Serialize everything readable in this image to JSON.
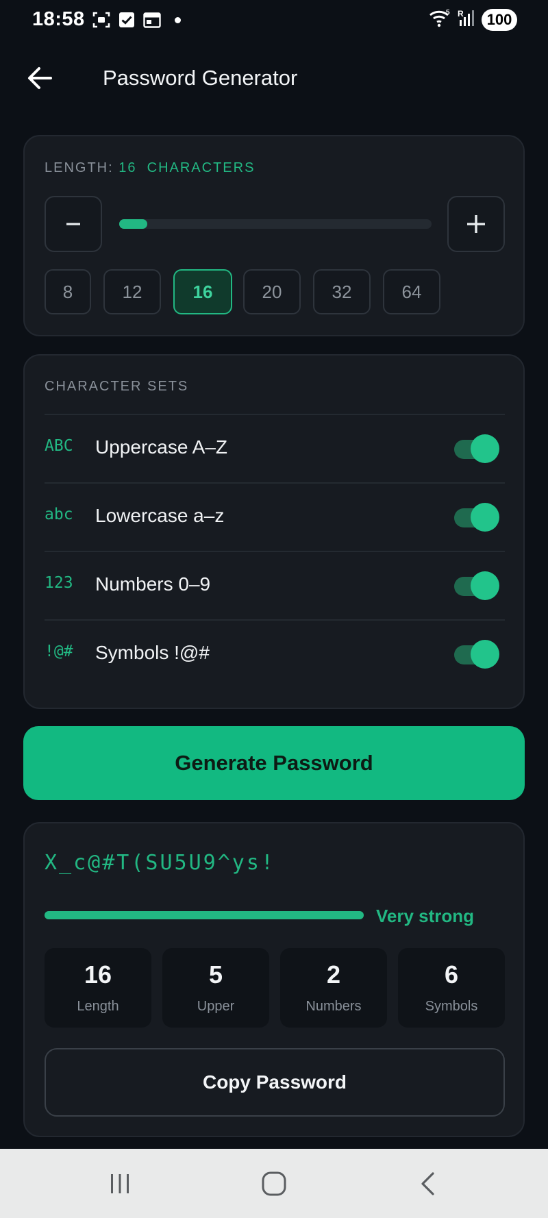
{
  "status_bar": {
    "time": "18:58",
    "battery": "100",
    "icons": [
      "screenshot-icon",
      "checkbox-icon",
      "calendar-icon",
      "dot-icon",
      "wifi-icon",
      "signal-icon",
      "battery-icon"
    ]
  },
  "header": {
    "title": "Password Generator",
    "back_icon": "arrow-left-icon"
  },
  "length_card": {
    "label_prefix": "LENGTH:",
    "value": "16",
    "label_suffix": "CHARACTERS",
    "minus_label": "−",
    "plus_label": "+",
    "slider_fraction": 0.09,
    "presets": [
      "8",
      "12",
      "16",
      "20",
      "32",
      "64"
    ],
    "selected_preset": "16"
  },
  "character_sets": {
    "title": "CHARACTER SETS",
    "items": [
      {
        "tag": "ABC",
        "label": "Uppercase  A–Z",
        "enabled": true
      },
      {
        "tag": "abc",
        "label": "Lowercase  a–z",
        "enabled": true
      },
      {
        "tag": "123",
        "label": "Numbers  0–9",
        "enabled": true
      },
      {
        "tag": "!@#",
        "label": "Symbols  !@#",
        "enabled": true
      }
    ]
  },
  "generate_button": {
    "label": "Generate Password"
  },
  "result": {
    "password": "X_c@#T(SU5U9^ys!",
    "strength_label": "Very strong",
    "strength_fraction": 1.0,
    "stats": [
      {
        "value": "16",
        "label": "Length"
      },
      {
        "value": "5",
        "label": "Upper"
      },
      {
        "value": "2",
        "label": "Numbers"
      },
      {
        "value": "6",
        "label": "Symbols"
      }
    ],
    "copy_label": "Copy Password"
  },
  "colors": {
    "accent": "#22b883",
    "button": "#12b981",
    "background": "#0c1016",
    "card": "#171b21"
  },
  "nav_bar": {
    "icons": [
      "recents-icon",
      "home-icon",
      "back-nav-icon"
    ]
  }
}
